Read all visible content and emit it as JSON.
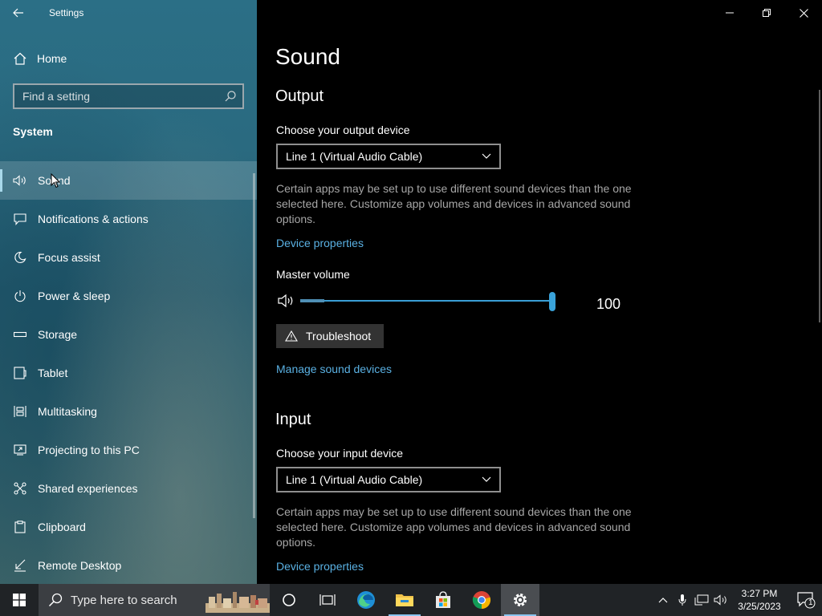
{
  "window": {
    "title": "Settings"
  },
  "sidebar": {
    "home_label": "Home",
    "search_placeholder": "Find a setting",
    "section_title": "System",
    "items": [
      {
        "label": "Sound",
        "icon": "speaker-icon",
        "active": true
      },
      {
        "label": "Notifications & actions",
        "icon": "notification-icon"
      },
      {
        "label": "Focus assist",
        "icon": "moon-icon"
      },
      {
        "label": "Power & sleep",
        "icon": "power-icon"
      },
      {
        "label": "Storage",
        "icon": "storage-icon"
      },
      {
        "label": "Tablet",
        "icon": "tablet-icon"
      },
      {
        "label": "Multitasking",
        "icon": "multitasking-icon"
      },
      {
        "label": "Projecting to this PC",
        "icon": "projecting-icon"
      },
      {
        "label": "Shared experiences",
        "icon": "shared-icon"
      },
      {
        "label": "Clipboard",
        "icon": "clipboard-icon"
      },
      {
        "label": "Remote Desktop",
        "icon": "remote-desktop-icon"
      }
    ]
  },
  "main": {
    "page_title": "Sound",
    "output": {
      "heading": "Output",
      "device_label": "Choose your output device",
      "device_value": "Line 1 (Virtual Audio Cable)",
      "description": "Certain apps may be set up to use different sound devices than the one selected here. Customize app volumes and devices in advanced sound options.",
      "device_properties_link": "Device properties",
      "master_volume_label": "Master volume",
      "volume_value": "100",
      "troubleshoot_label": "Troubleshoot",
      "manage_devices_link": "Manage sound devices"
    },
    "input": {
      "heading": "Input",
      "device_label": "Choose your input device",
      "device_value": "Line 1 (Virtual Audio Cable)",
      "description": "Certain apps may be set up to use different sound devices than the one selected here. Customize app volumes and devices in advanced sound options.",
      "device_properties_link": "Device properties"
    }
  },
  "taskbar": {
    "search_placeholder": "Type here to search",
    "apps": [
      "cortana-icon",
      "task-view-icon",
      "edge-icon",
      "file-explorer-icon",
      "store-icon",
      "chrome-icon",
      "settings-icon"
    ],
    "clock_time": "3:27 PM",
    "clock_date": "3/25/2023",
    "notification_count": "1"
  },
  "colors": {
    "accent": "#3aa3da",
    "link": "#5ab1e3",
    "taskbar": "#202326"
  }
}
